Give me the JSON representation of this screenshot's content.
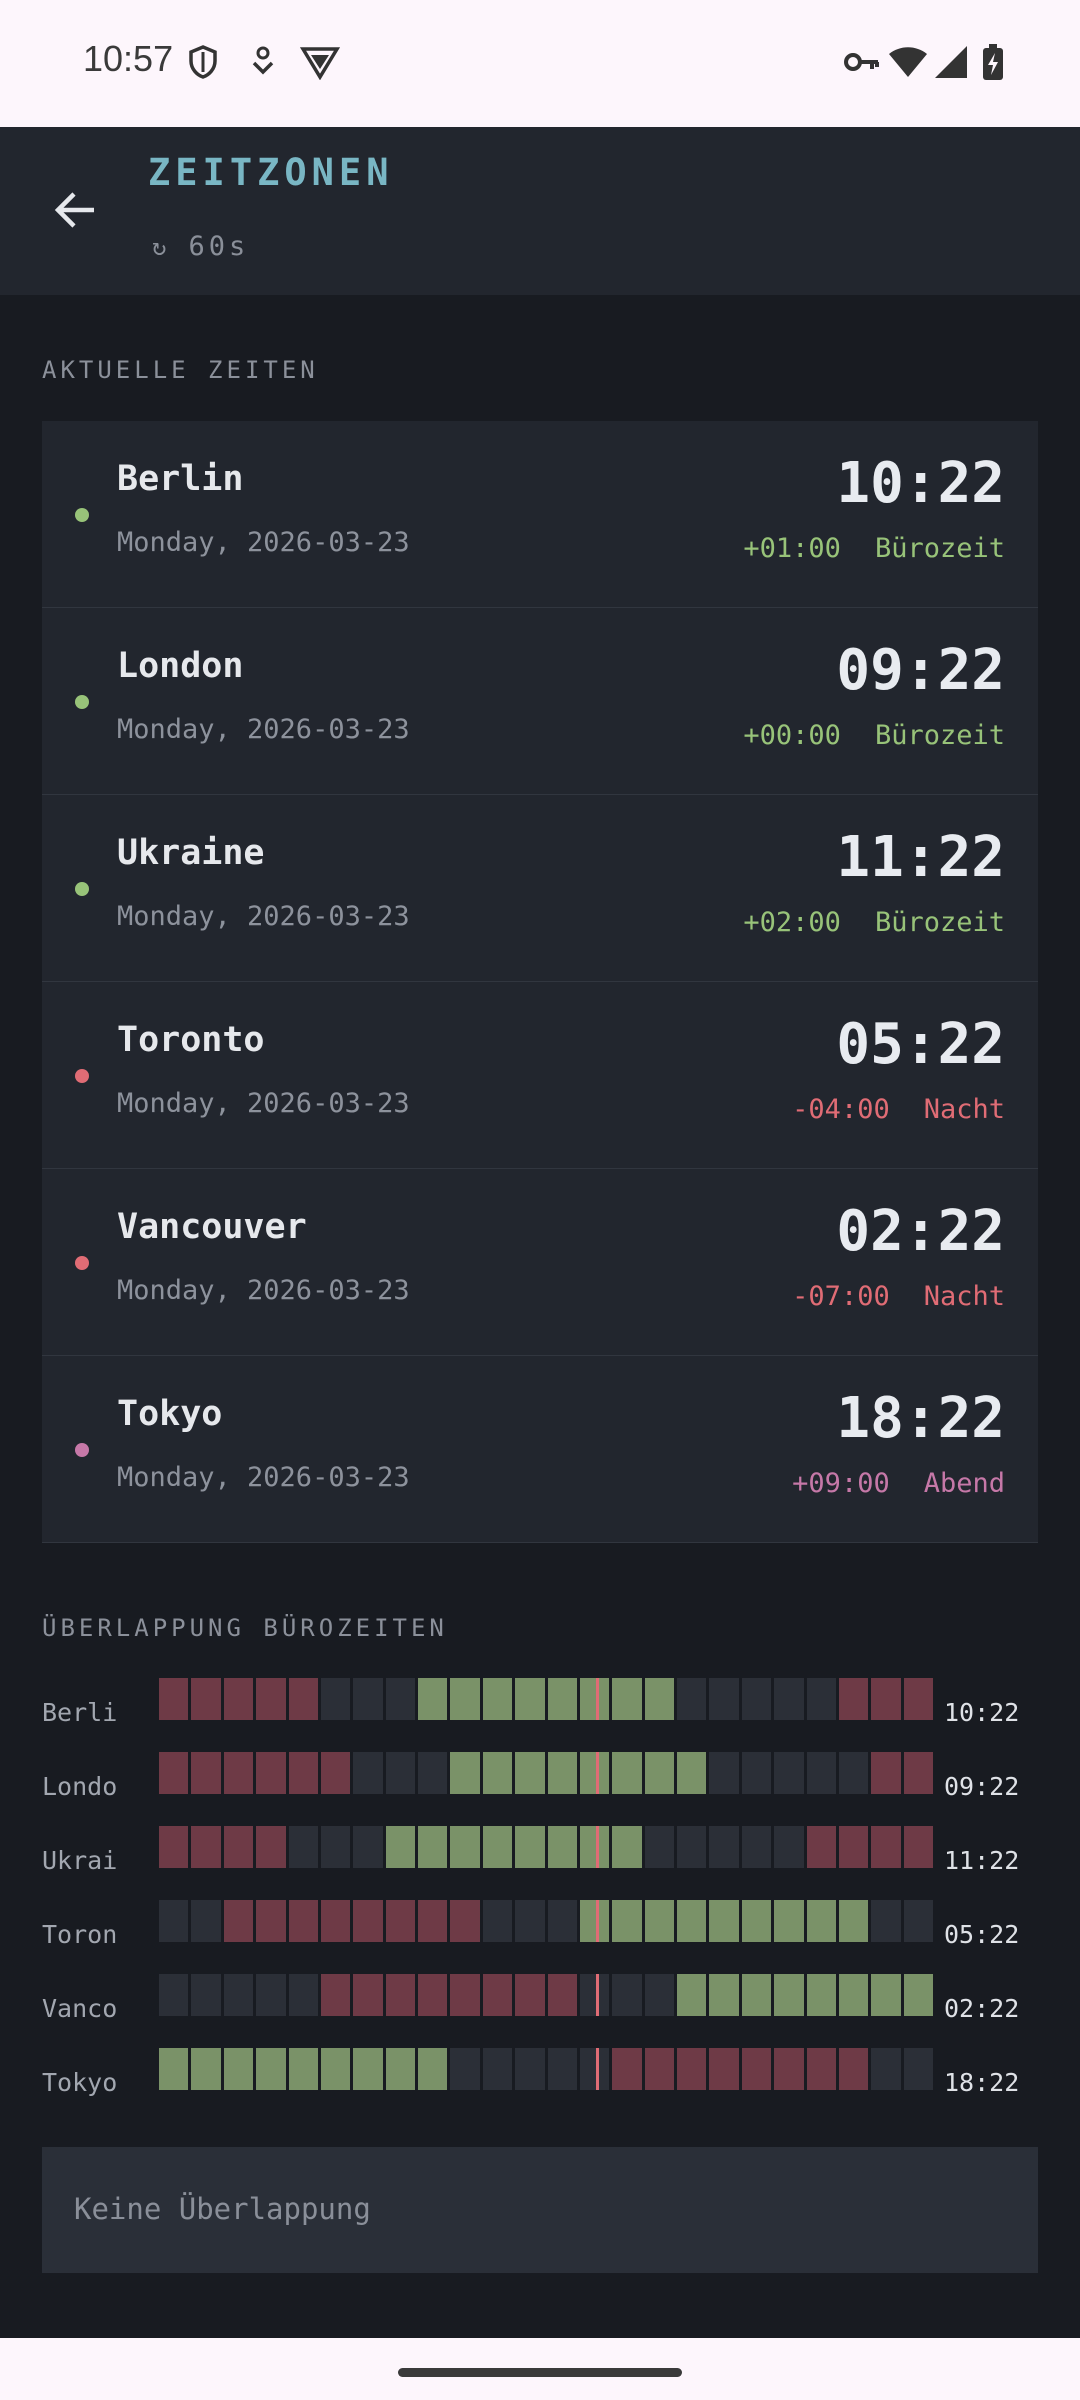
{
  "status_bar": {
    "time": "10:57"
  },
  "app_bar": {
    "title": "ZEITZONEN",
    "refresh_interval": "60s"
  },
  "sections": {
    "current_times": "AKTUELLE ZEITEN",
    "overlap": "ÜBERLAPPUNG BÜROZEITEN"
  },
  "zones": [
    {
      "name": "Berlin",
      "date": "Monday, 2026-03-23",
      "time": "10:22",
      "offset": "+01:00",
      "status": "Bürozeit",
      "color": "#98c379"
    },
    {
      "name": "London",
      "date": "Monday, 2026-03-23",
      "time": "09:22",
      "offset": "+00:00",
      "status": "Bürozeit",
      "color": "#98c379"
    },
    {
      "name": "Ukraine",
      "date": "Monday, 2026-03-23",
      "time": "11:22",
      "offset": "+02:00",
      "status": "Bürozeit",
      "color": "#98c379"
    },
    {
      "name": "Toronto",
      "date": "Monday, 2026-03-23",
      "time": "05:22",
      "offset": "-04:00",
      "status": "Nacht",
      "color": "#e06c75"
    },
    {
      "name": "Vancouver",
      "date": "Monday, 2026-03-23",
      "time": "02:22",
      "offset": "-07:00",
      "status": "Nacht",
      "color": "#e06c75"
    },
    {
      "name": "Tokyo",
      "date": "Monday, 2026-03-23",
      "time": "18:22",
      "offset": "+09:00",
      "status": "Abend",
      "color": "#c678a8"
    }
  ],
  "overlap_rows": [
    {
      "city": "Berli",
      "time": "10:22",
      "hours": "nnnnneeeooooooooeeeeennn"
    },
    {
      "city": "Londo",
      "time": "09:22",
      "hours": "nnnnnneeeooooooooeeeeenn"
    },
    {
      "city": "Ukrai",
      "time": "11:22",
      "hours": "nnnneeeooooooooeeeeennnn"
    },
    {
      "city": "Toron",
      "time": "05:22",
      "hours": "eennnnnnnneeeoooooooooeee"
    },
    {
      "city": "Vanco",
      "time": "02:22",
      "hours": "eeeeennnnnnnneeeooooooooo"
    },
    {
      "city": "Tokyo",
      "time": "18:22",
      "hours": "oooooooooeeeeennnnnnnneee"
    }
  ],
  "overlap_colors": {
    "o": "#7a9268",
    "n": "#6e3a46",
    "e": "#2b2f37",
    "now": "#e06c75"
  },
  "overlap_result": "Keine Überlappung"
}
